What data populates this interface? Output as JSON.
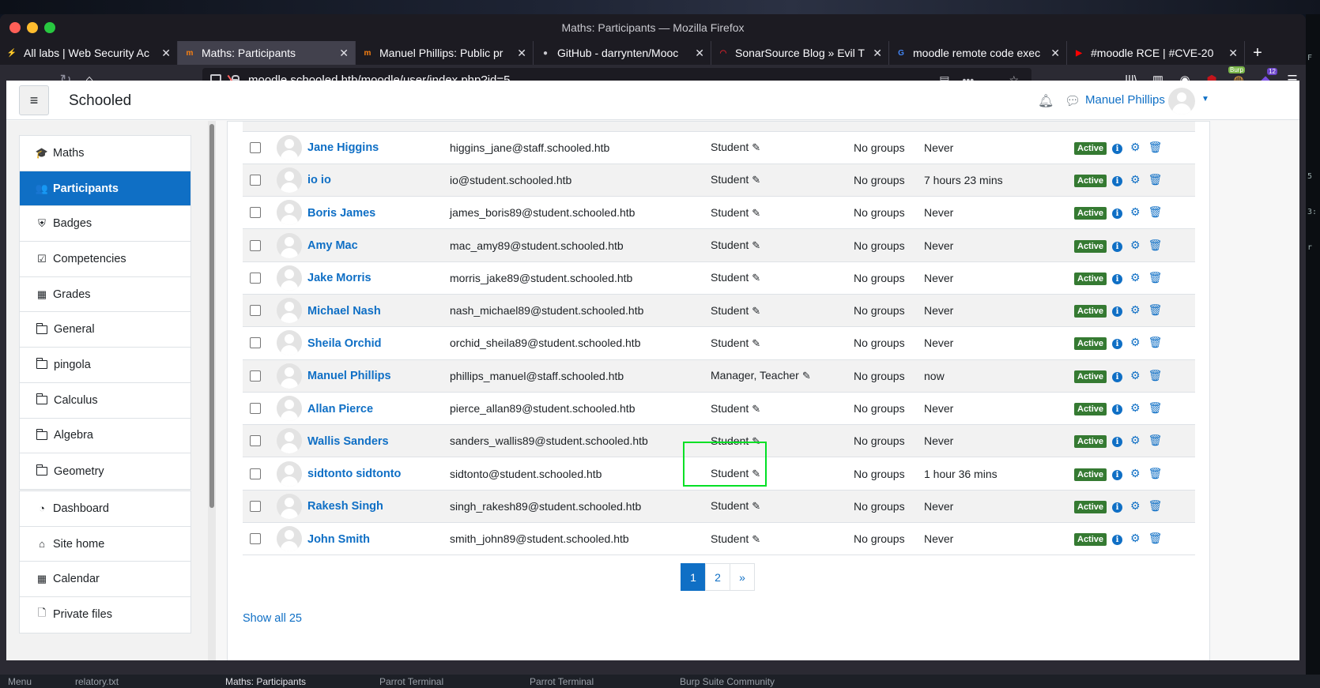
{
  "window": {
    "title": "Maths: Participants — Mozilla Firefox"
  },
  "tabs": [
    {
      "label": "All labs | Web Security Ac",
      "fav": "⚡",
      "fav_color": "#ff6633"
    },
    {
      "label": "Maths: Participants",
      "fav": "m",
      "fav_color": "#f98012",
      "active": true
    },
    {
      "label": "Manuel Phillips: Public pr",
      "fav": "m",
      "fav_color": "#f98012"
    },
    {
      "label": "GitHub - darrynten/Mooc",
      "fav": "●",
      "fav_color": "#c9c9cf"
    },
    {
      "label": "SonarSource Blog » Evil T",
      "fav": "◠",
      "fav_color": "#cb2029"
    },
    {
      "label": "moodle remote code exec",
      "fav": "G",
      "fav_color": "#4285f4"
    },
    {
      "label": "#moodle RCE | #CVE-20",
      "fav": "▶",
      "fav_color": "#ff0000"
    }
  ],
  "url": "moodle.schooled.htb/moodle/user/index.php?id=5",
  "toolbar": {
    "burp_badge": "Burp",
    "ext_count": "12"
  },
  "header": {
    "site_name": "Schooled",
    "user_name": "Manuel Phillips"
  },
  "nav": {
    "course": [
      {
        "label": "Maths",
        "icon": "graduation-cap-icon",
        "glyph": "🎓"
      },
      {
        "label": "Participants",
        "icon": "users-icon",
        "glyph": "👥",
        "active": true
      },
      {
        "label": "Badges",
        "icon": "shield-icon",
        "glyph": "⛨"
      },
      {
        "label": "Competencies",
        "icon": "checkbox-icon",
        "glyph": "☑"
      },
      {
        "label": "Grades",
        "icon": "table-icon",
        "glyph": "▦"
      },
      {
        "label": "General",
        "icon": "folder-icon",
        "glyph": ""
      },
      {
        "label": "pingola",
        "icon": "folder-icon",
        "glyph": ""
      },
      {
        "label": "Calculus",
        "icon": "folder-icon",
        "glyph": ""
      },
      {
        "label": "Algebra",
        "icon": "folder-icon",
        "glyph": ""
      },
      {
        "label": "Geometry",
        "icon": "folder-icon",
        "glyph": ""
      }
    ],
    "site": [
      {
        "label": "Dashboard",
        "icon": "dashboard-icon",
        "glyph": "◔"
      },
      {
        "label": "Site home",
        "icon": "home-icon",
        "glyph": "⌂"
      },
      {
        "label": "Calendar",
        "icon": "calendar-icon",
        "glyph": "▦"
      },
      {
        "label": "Private files",
        "icon": "file-icon",
        "glyph": "🗋"
      }
    ]
  },
  "participants": [
    {
      "name": "Jane Higgins",
      "email": "higgins_jane@staff.schooled.htb",
      "role": "Student",
      "groups": "No groups",
      "last_access": "Never",
      "status": "Active"
    },
    {
      "name": "io io",
      "email": "io@student.schooled.htb",
      "role": "Student",
      "groups": "No groups",
      "last_access": "7 hours 23 mins",
      "status": "Active"
    },
    {
      "name": "Boris James",
      "email": "james_boris89@student.schooled.htb",
      "role": "Student",
      "groups": "No groups",
      "last_access": "Never",
      "status": "Active"
    },
    {
      "name": "Amy Mac",
      "email": "mac_amy89@student.schooled.htb",
      "role": "Student",
      "groups": "No groups",
      "last_access": "Never",
      "status": "Active"
    },
    {
      "name": "Jake Morris",
      "email": "morris_jake89@student.schooled.htb",
      "role": "Student",
      "groups": "No groups",
      "last_access": "Never",
      "status": "Active"
    },
    {
      "name": "Michael Nash",
      "email": "nash_michael89@student.schooled.htb",
      "role": "Student",
      "groups": "No groups",
      "last_access": "Never",
      "status": "Active"
    },
    {
      "name": "Sheila Orchid",
      "email": "orchid_sheila89@student.schooled.htb",
      "role": "Student",
      "groups": "No groups",
      "last_access": "Never",
      "status": "Active"
    },
    {
      "name": "Manuel Phillips",
      "email": "phillips_manuel@staff.schooled.htb",
      "role": "Manager, Teacher",
      "groups": "No groups",
      "last_access": "now",
      "status": "Active"
    },
    {
      "name": "Allan Pierce",
      "email": "pierce_allan89@student.schooled.htb",
      "role": "Student",
      "groups": "No groups",
      "last_access": "Never",
      "status": "Active"
    },
    {
      "name": "Wallis Sanders",
      "email": "sanders_wallis89@student.schooled.htb",
      "role": "Student",
      "groups": "No groups",
      "last_access": "Never",
      "status": "Active"
    },
    {
      "name": "sidtonto sidtonto",
      "email": "sidtonto@student.schooled.htb",
      "role": "Student",
      "groups": "No groups",
      "last_access": "1 hour 36 mins",
      "status": "Active"
    },
    {
      "name": "Rakesh Singh",
      "email": "singh_rakesh89@student.schooled.htb",
      "role": "Student",
      "groups": "No groups",
      "last_access": "Never",
      "status": "Active"
    },
    {
      "name": "John Smith",
      "email": "smith_john89@student.schooled.htb",
      "role": "Student",
      "groups": "No groups",
      "last_access": "Never",
      "status": "Active"
    }
  ],
  "pagination": {
    "pages": [
      "1",
      "2"
    ],
    "current": "1",
    "next": "»"
  },
  "show_all": "Show all 25",
  "taskbar": [
    {
      "label": "Menu"
    },
    {
      "label": "relatory.txt"
    },
    {
      "label": "Maths: Participants"
    },
    {
      "label": "Parrot Terminal"
    },
    {
      "label": "Parrot Terminal"
    },
    {
      "label": "Burp Suite Community"
    }
  ],
  "colors": {
    "accent": "#0f6fc5",
    "active_badge": "#357a32",
    "highlight_box": "#00e025"
  }
}
